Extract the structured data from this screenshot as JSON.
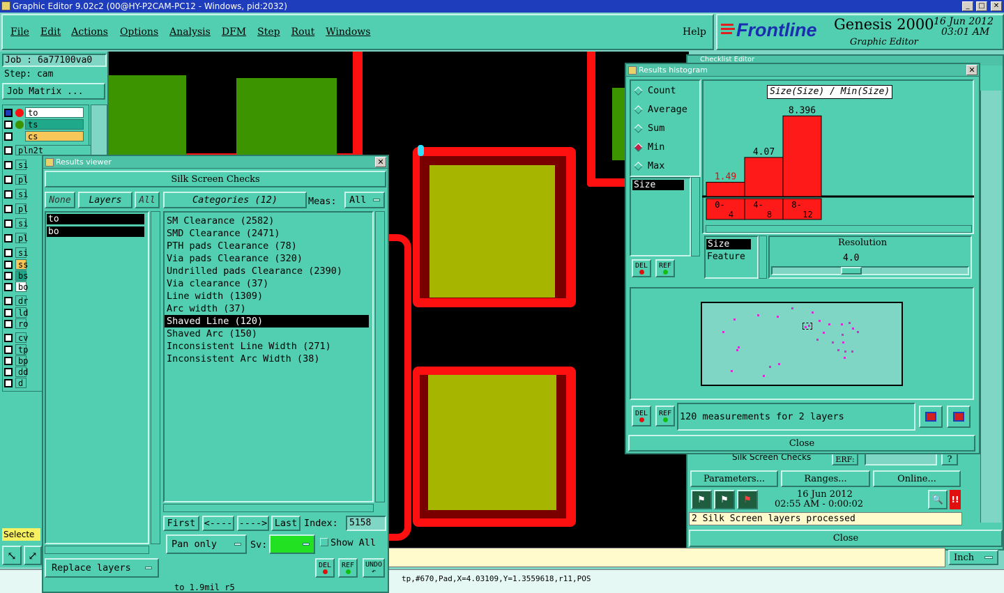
{
  "window": {
    "title": "Graphic Editor 9.02c2 (00@HY-P2CAM-PC12 - Windows, pid:2032)"
  },
  "menu": {
    "items": [
      "File",
      "Edit",
      "Actions",
      "Options",
      "Analysis",
      "DFM",
      "Step",
      "Rout",
      "Windows"
    ],
    "help": "Help"
  },
  "brand": {
    "logo": "Frontline",
    "product": "Genesis 2000",
    "subtitle": "Graphic Editor",
    "date": "16 Jun 2012",
    "time": "03:01 AM"
  },
  "job": {
    "job_label": "Job : 6a77100va0",
    "step_label": "Step: cam",
    "matrix_button": "Job Matrix ..."
  },
  "layers": [
    {
      "name": "to",
      "color": "#ffffff"
    },
    {
      "name": "ts",
      "color": "#1fa88a"
    },
    {
      "name": "cs",
      "color": "#f7c75a"
    },
    {
      "name": "pln2t",
      "color": "#52ceb0"
    },
    {
      "name": "si",
      "color": "#52ceb0"
    },
    {
      "name": "pl",
      "color": "#52ceb0"
    },
    {
      "name": "si",
      "color": "#52ceb0"
    },
    {
      "name": "pl",
      "color": "#52ceb0"
    },
    {
      "name": "si",
      "color": "#52ceb0"
    },
    {
      "name": "pl",
      "color": "#52ceb0"
    },
    {
      "name": "si",
      "color": "#52ceb0"
    },
    {
      "name": "ss",
      "color": "#f7c75a"
    },
    {
      "name": "bs",
      "color": "#1fa88a"
    },
    {
      "name": "bo",
      "color": "#ffffff"
    },
    {
      "name": "dr",
      "color": "#52ceb0"
    },
    {
      "name": "ld",
      "color": "#52ceb0"
    },
    {
      "name": "ro",
      "color": "#52ceb0"
    },
    {
      "name": "cv",
      "color": "#52ceb0"
    },
    {
      "name": "tp",
      "color": "#52ceb0"
    },
    {
      "name": "bp",
      "color": "#52ceb0"
    },
    {
      "name": "dd",
      "color": "#52ceb0"
    },
    {
      "name": "d",
      "color": "#52ceb0"
    }
  ],
  "left_bottom": {
    "selected": "Selecte"
  },
  "results_viewer": {
    "title": "Results viewer",
    "header": "Silk Screen Checks",
    "none_btn": "None",
    "layers_btn": "Layers",
    "all_btn": "All",
    "layer_list": [
      "to",
      "bo"
    ],
    "categories_btn": "Categories (12)",
    "meas_label": "Meas:",
    "meas_value": "All",
    "categories": [
      "SM Clearance (2582)",
      "SMD Clearance (2471)",
      "PTH pads Clearance (78)",
      "Via pads Clearance (320)",
      "Undrilled pads Clearance (2390)",
      "Via clearance (37)",
      "Line width (1309)",
      "Arc width (37)",
      "Shaved Line (120)",
      "Shaved Arc (150)",
      "Inconsistent Line Width (271)",
      "Inconsistent Arc Width (38)"
    ],
    "selected_category": "Shaved Line (120)",
    "first": "First",
    "prev": "<----",
    "next": "---->",
    "last": "Last",
    "index_label": "Index:",
    "index_value": "5158",
    "pan_mode": "Pan only",
    "sv_label": "Sv:",
    "show_all": "Show All",
    "replace_layers": "Replace layers",
    "del": "DEL",
    "ref": "REF",
    "undo": "UNDO",
    "status": "to 1.9mil r5"
  },
  "histogram": {
    "title": "Results histogram",
    "options": [
      "Count",
      "Average",
      "Sum",
      "Min",
      "Max"
    ],
    "selected_option": "Min",
    "chart_title": "Size(Size) / Min(Size)",
    "list_item": "Size",
    "list2": [
      "Size",
      "Feature"
    ],
    "resolution_label": "Resolution",
    "resolution_value": "4.0",
    "del": "DEL",
    "ref": "REF",
    "summary": "120 measurements for 2 layers",
    "close": "Close"
  },
  "chart_data": {
    "type": "bar",
    "title": "Size(Size) / Min(Size)",
    "categories": [
      "0-4",
      "4-8",
      "8-12"
    ],
    "values": [
      1.49,
      4.07,
      8.396
    ],
    "value_labels": [
      "1.49",
      "4.07",
      "8.396"
    ],
    "tick_labels": [
      [
        "0-",
        "4"
      ],
      [
        "4-",
        "8"
      ],
      [
        "8-",
        "12"
      ]
    ],
    "ylim": [
      0,
      9
    ]
  },
  "checklist": {
    "title": "Checklist Editor",
    "row_label": "Silk Screen Checks",
    "erf": "ERF:",
    "parameters": "Parameters...",
    "ranges": "Ranges...",
    "online": "Online...",
    "date": "16 Jun 2012",
    "time": "02:55 AM - 0:00:02",
    "status": "2 Silk Screen layers processed",
    "close": "Close"
  },
  "bottom": {
    "units": "Inch",
    "coords": "tp,#670,Pad,X=4.03109,Y=1.3559618,r11,POS"
  },
  "colors": {
    "accent": "#52ceb0",
    "copper": "#ff1010",
    "pad": "#a6b600",
    "titlebar": "#1e3dbd"
  }
}
